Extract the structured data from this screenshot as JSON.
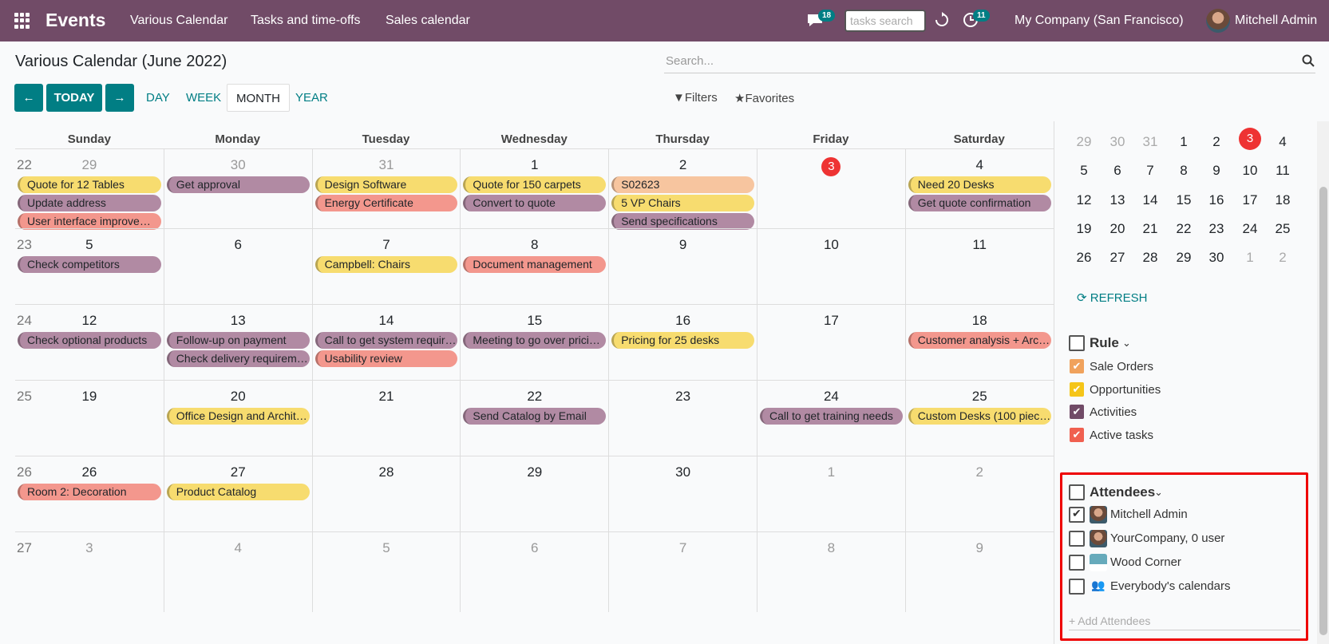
{
  "app": {
    "name": "Events",
    "menu": [
      "Various Calendar",
      "Tasks and time-offs",
      "Sales calendar"
    ],
    "chat_badge": "18",
    "task_search_placeholder": "tasks search",
    "activity_badge": "11",
    "company": "My Company (San Francisco)",
    "user": "Mitchell Admin"
  },
  "page": {
    "title": "Various Calendar (June 2022)",
    "search_placeholder": "Search...",
    "today_label": "TODAY",
    "modes": [
      "DAY",
      "WEEK",
      "MONTH",
      "YEAR"
    ],
    "active_mode": "MONTH",
    "filters": "Filters",
    "favorites": "Favorites"
  },
  "calendar": {
    "days": [
      "Sunday",
      "Monday",
      "Tuesday",
      "Wednesday",
      "Thursday",
      "Friday",
      "Saturday"
    ],
    "weeks": [
      {
        "num": "22",
        "days": [
          {
            "d": "29",
            "o": true,
            "ev": [
              [
                "Quote for 12 Tables",
                "y"
              ],
              [
                "Update address",
                "p"
              ],
              [
                "User interface improve…",
                "r"
              ]
            ]
          },
          {
            "d": "30",
            "o": true,
            "ev": [
              [
                "Get approval",
                "p"
              ]
            ]
          },
          {
            "d": "31",
            "o": true,
            "ev": [
              [
                "Design Software",
                "y"
              ],
              [
                "Energy Certificate",
                "r"
              ]
            ]
          },
          {
            "d": "1",
            "ev": [
              [
                "Quote for 150 carpets",
                "y"
              ],
              [
                "Convert to quote",
                "p"
              ]
            ]
          },
          {
            "d": "2",
            "ev": [
              [
                "S02623",
                "o"
              ],
              [
                "5 VP Chairs",
                "y"
              ],
              [
                "Send specifications",
                "p"
              ]
            ]
          },
          {
            "d": "3",
            "today": true,
            "ev": []
          },
          {
            "d": "4",
            "ev": [
              [
                "Need 20 Desks",
                "y"
              ],
              [
                "Get quote confirmation",
                "p"
              ]
            ]
          }
        ]
      },
      {
        "num": "23",
        "days": [
          {
            "d": "5",
            "ev": [
              [
                "Check competitors",
                "p"
              ]
            ]
          },
          {
            "d": "6",
            "ev": []
          },
          {
            "d": "7",
            "ev": [
              [
                "Campbell: Chairs",
                "y"
              ]
            ]
          },
          {
            "d": "8",
            "ev": [
              [
                "Document management",
                "r"
              ]
            ]
          },
          {
            "d": "9",
            "ev": []
          },
          {
            "d": "10",
            "ev": []
          },
          {
            "d": "11",
            "ev": []
          }
        ]
      },
      {
        "num": "24",
        "days": [
          {
            "d": "12",
            "ev": [
              [
                "Check optional products",
                "p"
              ]
            ]
          },
          {
            "d": "13",
            "ev": [
              [
                "Follow-up on payment",
                "p"
              ],
              [
                "Check delivery requirem…",
                "p"
              ]
            ]
          },
          {
            "d": "14",
            "ev": [
              [
                "Call to get system requir…",
                "p"
              ],
              [
                "Usability review",
                "r"
              ]
            ]
          },
          {
            "d": "15",
            "ev": [
              [
                "Meeting to go over prici…",
                "p"
              ]
            ]
          },
          {
            "d": "16",
            "ev": [
              [
                "Pricing for 25 desks",
                "y"
              ]
            ]
          },
          {
            "d": "17",
            "ev": []
          },
          {
            "d": "18",
            "ev": [
              [
                "Customer analysis + Arc…",
                "r"
              ]
            ]
          }
        ]
      },
      {
        "num": "25",
        "days": [
          {
            "d": "19",
            "ev": []
          },
          {
            "d": "20",
            "ev": [
              [
                "Office Design and Archit…",
                "y"
              ]
            ]
          },
          {
            "d": "21",
            "ev": []
          },
          {
            "d": "22",
            "ev": [
              [
                "Send Catalog by Email",
                "p"
              ]
            ]
          },
          {
            "d": "23",
            "ev": []
          },
          {
            "d": "24",
            "ev": [
              [
                "Call to get training needs",
                "p"
              ]
            ]
          },
          {
            "d": "25",
            "ev": [
              [
                "Custom Desks (100 piec…",
                "y"
              ]
            ]
          }
        ]
      },
      {
        "num": "26",
        "days": [
          {
            "d": "26",
            "ev": [
              [
                "Room 2: Decoration",
                "r"
              ]
            ]
          },
          {
            "d": "27",
            "ev": [
              [
                "Product Catalog",
                "y"
              ]
            ]
          },
          {
            "d": "28",
            "ev": []
          },
          {
            "d": "29",
            "ev": []
          },
          {
            "d": "30",
            "ev": []
          },
          {
            "d": "1",
            "o": true,
            "ev": []
          },
          {
            "d": "2",
            "o": true,
            "ev": []
          }
        ]
      },
      {
        "num": "27",
        "days": [
          {
            "d": "3",
            "o": true,
            "ev": []
          },
          {
            "d": "4",
            "o": true,
            "ev": []
          },
          {
            "d": "5",
            "o": true,
            "ev": []
          },
          {
            "d": "6",
            "o": true,
            "ev": []
          },
          {
            "d": "7",
            "o": true,
            "ev": []
          },
          {
            "d": "8",
            "o": true,
            "ev": []
          },
          {
            "d": "9",
            "o": true,
            "ev": []
          }
        ]
      }
    ]
  },
  "colors": {
    "y": "#f7dc6f",
    "p": "#b18aa3",
    "r": "#f3978d",
    "o": "#f7c59f"
  },
  "mini": {
    "rows": [
      [
        "29",
        "30",
        "31",
        "1",
        "2",
        "3",
        "4"
      ],
      [
        "5",
        "6",
        "7",
        "8",
        "9",
        "10",
        "11"
      ],
      [
        "12",
        "13",
        "14",
        "15",
        "16",
        "17",
        "18"
      ],
      [
        "19",
        "20",
        "21",
        "22",
        "23",
        "24",
        "25"
      ],
      [
        "26",
        "27",
        "28",
        "29",
        "30",
        "1",
        "2"
      ]
    ],
    "refresh": "REFRESH"
  },
  "rule": {
    "title": "Rule",
    "items": [
      {
        "label": "Sale Orders",
        "color": "#f0a25c"
      },
      {
        "label": "Opportunities",
        "color": "#f5c518"
      },
      {
        "label": "Activities",
        "color": "#714b67"
      },
      {
        "label": "Active tasks",
        "color": "#f06050"
      }
    ]
  },
  "attendees": {
    "title": "Attendees",
    "items": [
      "Mitchell Admin",
      "YourCompany, 0 user",
      "Wood Corner",
      "Everybody's calendars"
    ],
    "add_placeholder": "+ Add Attendees"
  }
}
